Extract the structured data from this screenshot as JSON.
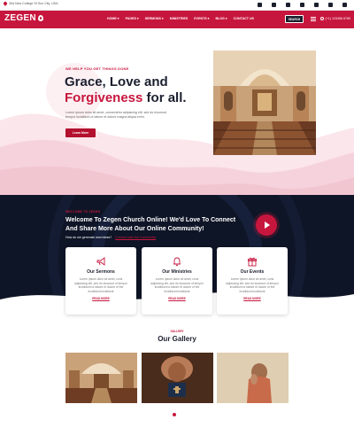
{
  "topbar": {
    "address": "30a New College St Sun City, USA",
    "socials": [
      "facebook-icon",
      "twitter-icon",
      "instagram-icon",
      "pinterest-icon",
      "youtube-icon",
      "user-icon",
      "cart-icon"
    ]
  },
  "nav": {
    "logo": "ZEGEN",
    "menu": [
      "HOME ▾",
      "PAGES ▾",
      "SERMONS ▾",
      "MINISTRIES",
      "EVENTS ▾",
      "BLOG ▾",
      "CONTACT US"
    ],
    "search_label": "SEARCH",
    "phone": "(+1) 123456 6789"
  },
  "hero": {
    "eyebrow": "WE HELP YOU GET THINGS DONE",
    "headline_line1": "Grace, Love and",
    "headline_accent": "Forgiveness",
    "headline_tail": " for all.",
    "description": "Lorem ipsum dolor sit amet, consectetur adipiscing elit, sed do eiusmod tempor incididunt ut labore et dolore magna aliqua enim.",
    "button": "Learn More"
  },
  "community": {
    "eyebrow": "WELCOME TO ZEGEN",
    "heading": "Welcome To Zegen Church Online! We'd Love To Connect And Share More About Our Online Community!",
    "question": "How do we generate new ideas?",
    "link": "Connect with the Community"
  },
  "cards": [
    {
      "title": "Our Sermons",
      "text": "Lorem ipsum dolor sit amet, cons adipiscing elit, sed do eiusmod of tempor incididunt ut labore et dolore of the Incididunt incididunt",
      "more": "READ MORE",
      "icon": "megaphone-icon"
    },
    {
      "title": "Our Ministries",
      "text": "Lorem ipsum dolor sit amet, cons adipiscing elit, sed do eiusmod of tempor incididunt ut labore et dolore of the Incididunt incididunt",
      "more": "READ MORE",
      "icon": "bell-icon"
    },
    {
      "title": "Our Events",
      "text": "Lorem ipsum dolor sit amet, cons adipiscing elit, sed do eiusmod of tempor incididunt ut labore et dolore of the Incididunt incididunt",
      "more": "READ MORE",
      "icon": "gift-icon"
    }
  ],
  "gallery": {
    "eyebrow": "GALLERY",
    "title": "Our Gallery",
    "images": [
      "church-interior-image",
      "praying-hands-bible-image",
      "praying-woman-image"
    ]
  },
  "colors": {
    "accent": "#c7163d",
    "dark": "#0e1526",
    "pink": "#f8dfe5"
  }
}
